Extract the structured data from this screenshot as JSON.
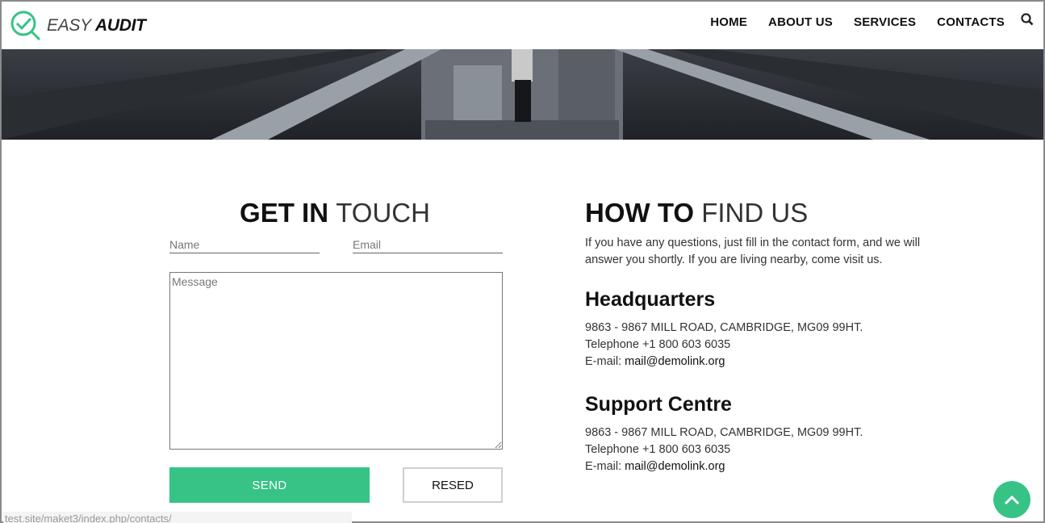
{
  "header": {
    "logo": {
      "light": "EASY",
      "bold": "AUDIT"
    },
    "nav": [
      {
        "label": "HOME"
      },
      {
        "label": "ABOUT US"
      },
      {
        "label": "SERVICES"
      },
      {
        "label": "CONTACTS"
      }
    ],
    "search_icon": "search-icon"
  },
  "contact_form": {
    "title_bold": "GET IN",
    "title_light": "TOUCH",
    "name_placeholder": "Name",
    "email_placeholder": "Email",
    "message_placeholder": "Message",
    "send_label": "SEND",
    "reset_label": "RESED"
  },
  "find_us": {
    "title_bold": "HOW TO",
    "title_light": "FIND US",
    "intro": "If you have any questions, just fill in the contact form, and we will answer you shortly. If you are living nearby, come visit us.",
    "offices": [
      {
        "name": "Headquarters",
        "address": "9863 - 9867 MILL ROAD, CAMBRIDGE, MG09 99HT.",
        "phone": "Telephone +1 800 603 6035",
        "email_label": "E-mail:",
        "email": "mail@demolink.org"
      },
      {
        "name": "Support Centre",
        "address": "9863 - 9867 MILL ROAD, CAMBRIDGE, MG09 99HT.",
        "phone": "Telephone +1 800 603 6035",
        "email_label": "E-mail:",
        "email": "mail@demolink.org"
      }
    ]
  },
  "status_bar": {
    "url": "test.site/maket3/index.php/contacts/"
  },
  "colors": {
    "accent": "#37c385",
    "hero": "#2e3137"
  }
}
